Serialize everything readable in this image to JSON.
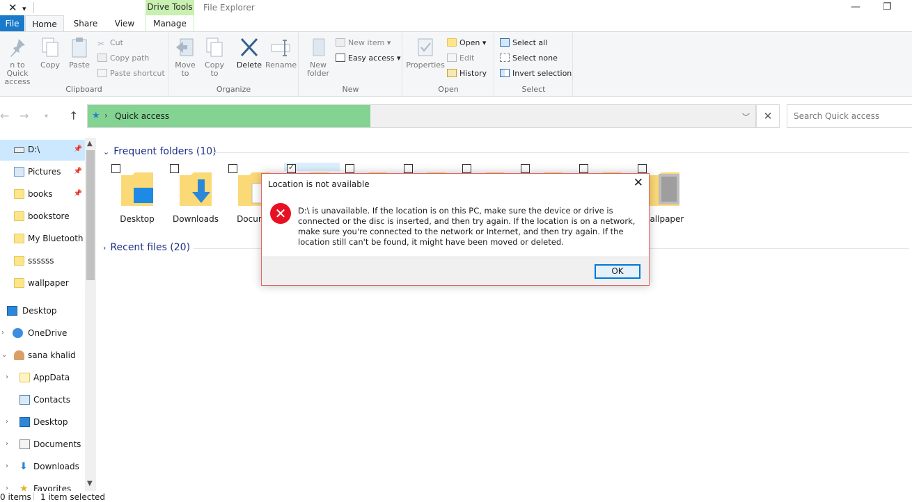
{
  "window": {
    "title": "File Explorer",
    "contextual_tab_header": "Drive Tools",
    "qat_icon": "x-icon",
    "controls": {
      "minimize": "—",
      "restore": "❐"
    }
  },
  "ribbon": {
    "tabs": [
      "File",
      "Home",
      "Share",
      "View",
      "Manage"
    ],
    "active_tab": "Home",
    "groups": {
      "clipboard": {
        "label": "Clipboard",
        "pin_label": "n to Quick access",
        "copy_label": "Copy",
        "paste_label": "Paste",
        "cut_label": "Cut",
        "copy_path_label": "Copy path",
        "paste_shortcut_label": "Paste shortcut"
      },
      "organize": {
        "label": "Organize",
        "move_to_label": "Move to",
        "copy_to_label": "Copy to",
        "delete_label": "Delete",
        "rename_label": "Rename"
      },
      "new": {
        "label": "New",
        "new_folder_label": "New folder",
        "new_item_label": "New item",
        "easy_access_label": "Easy access"
      },
      "open": {
        "label": "Open",
        "properties_label": "Properties",
        "open_label": "Open",
        "edit_label": "Edit",
        "history_label": "History"
      },
      "select": {
        "label": "Select",
        "select_all_label": "Select all",
        "select_none_label": "Select none",
        "invert_selection_label": "Invert selection"
      }
    }
  },
  "address": {
    "path": "Quick access",
    "search_placeholder": "Search Quick access"
  },
  "nav_pane": {
    "items": [
      {
        "label": "D:\\",
        "pinned": true
      },
      {
        "label": "Pictures",
        "pinned": true
      },
      {
        "label": "books",
        "pinned": true
      },
      {
        "label": "bookstore",
        "pinned": false
      },
      {
        "label": "My Bluetooth",
        "pinned": false
      },
      {
        "label": "ssssss",
        "pinned": false
      },
      {
        "label": "wallpaper",
        "pinned": false
      },
      {
        "label": "Desktop",
        "pinned": false
      },
      {
        "label": "OneDrive",
        "pinned": false
      },
      {
        "label": "sana khalid",
        "pinned": false
      },
      {
        "label": "AppData",
        "pinned": false
      },
      {
        "label": "Contacts",
        "pinned": false
      },
      {
        "label": "Desktop",
        "pinned": false
      },
      {
        "label": "Documents",
        "pinned": false
      },
      {
        "label": "Downloads",
        "pinned": false
      },
      {
        "label": "Favorites",
        "pinned": false
      }
    ]
  },
  "content": {
    "frequent_header": "Frequent folders (10)",
    "recent_header": "Recent files (20)",
    "tiles": [
      {
        "label": "Desktop",
        "checked": false
      },
      {
        "label": "Downloads",
        "checked": false
      },
      {
        "label": "Docume",
        "checked": false
      },
      {
        "label": "",
        "checked": true
      },
      {
        "label": "",
        "checked": false
      },
      {
        "label": "",
        "checked": false
      },
      {
        "label": "",
        "checked": false
      },
      {
        "label": "",
        "checked": false
      },
      {
        "label": "",
        "checked": false
      },
      {
        "label": "wallpaper",
        "checked": false
      }
    ]
  },
  "status": {
    "items_count": "0 items",
    "selection": "1 item selected"
  },
  "dialog": {
    "title": "Location is not available",
    "message": "D:\\ is unavailable. If the location is on this PC, make sure the device or drive is connected or the disc is inserted, and then try again. If the location is on a network, make sure you're connected to the network or Internet, and then try again. If the location still can't be found, it might have been moved or deleted.",
    "ok_label": "OK",
    "icon": "error-icon"
  },
  "colors": {
    "file_tab": "#1979ca",
    "drive_tools": "#c8f0b0",
    "address_highlight": "#83d392",
    "dialog_border": "#e46161",
    "error_red": "#e81123",
    "section_header": "#1e3287",
    "folder": "#fde68a"
  }
}
